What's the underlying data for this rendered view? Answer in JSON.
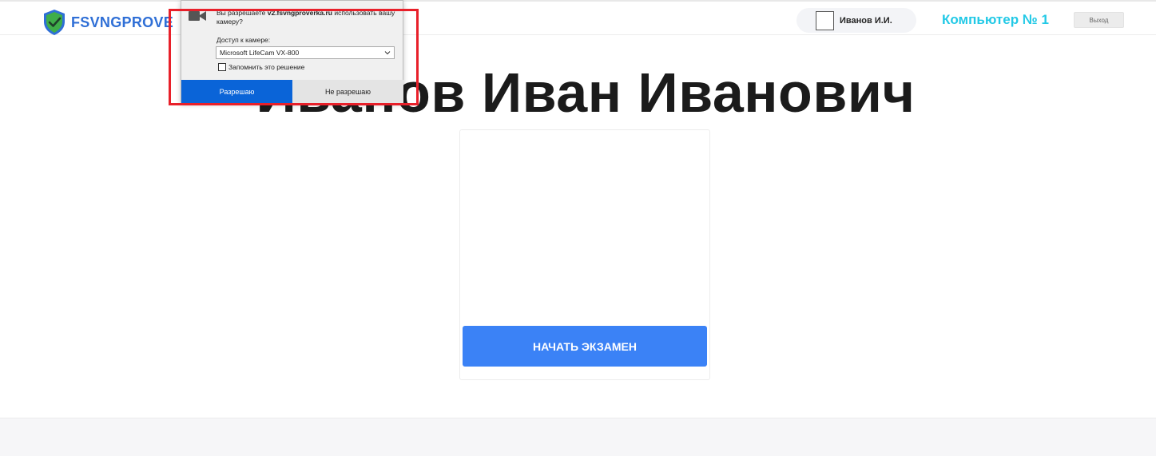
{
  "header": {
    "logo_text": "FSVNGPROVE",
    "logo_icon": "shield-check-icon",
    "user_name": "Иванов И.И.",
    "computer_label": "Компьютер № 1",
    "logout_label": "Выход"
  },
  "main": {
    "title": "Иванов Иван Иванович",
    "start_button": "НАЧАТЬ ЭКЗАМЕН"
  },
  "permission_popup": {
    "question_prefix": "Вы разрешаете ",
    "question_site": "v2.fsvngproverka.ru",
    "question_suffix": " использовать вашу камеру?",
    "access_label": "Доступ к камере:",
    "selected_camera": "Microsoft LifeCam VX-800",
    "remember_label": "Запомнить это решение",
    "allow_label": "Разрешаю",
    "deny_label": "Не разрешаю",
    "icon": "camera-icon"
  },
  "colors": {
    "brand_blue": "#2f6fd6",
    "accent_cyan": "#22c9e6",
    "button_blue": "#3b82f6",
    "highlight_red": "#e8202a"
  }
}
